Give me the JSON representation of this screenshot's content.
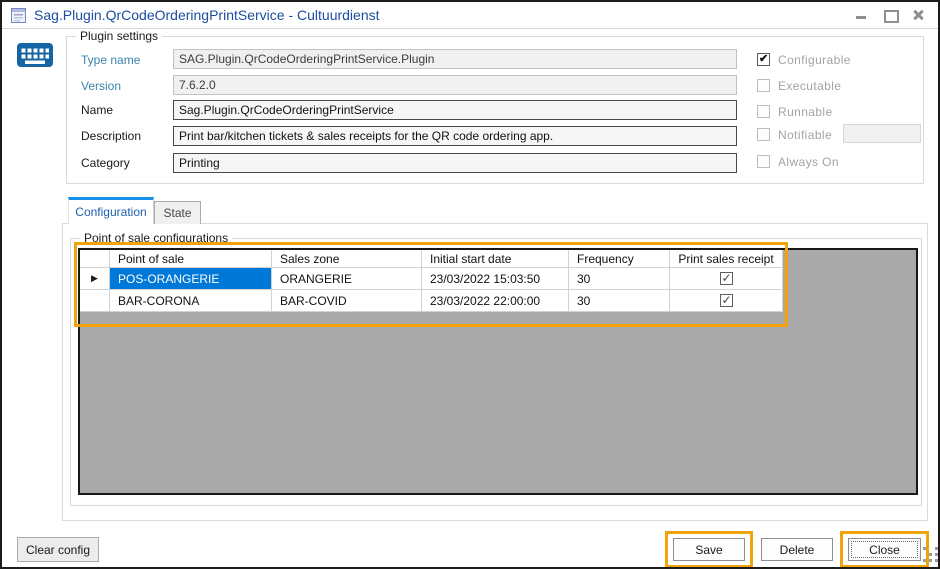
{
  "window": {
    "title": "Sag.Plugin.QrCodeOrderingPrintService - Cultuurdienst"
  },
  "plugin_settings": {
    "group_label": "Plugin settings",
    "fields": {
      "type_name": {
        "label": "Type name",
        "value": "SAG.Plugin.QrCodeOrderingPrintService.Plugin"
      },
      "version": {
        "label": "Version",
        "value": "7.6.2.0"
      },
      "name": {
        "label": "Name",
        "value": "Sag.Plugin.QrCodeOrderingPrintService"
      },
      "description": {
        "label": "Description",
        "value": "Print bar/kitchen tickets & sales receipts for the QR code ordering app."
      },
      "category": {
        "label": "Category",
        "value": "Printing"
      }
    },
    "checkboxes": {
      "configurable": {
        "label": "Configurable",
        "checked": true
      },
      "executable": {
        "label": "Executable",
        "checked": false
      },
      "runnable": {
        "label": "Runnable",
        "checked": false
      },
      "notifiable": {
        "label": "Notifiable",
        "checked": false,
        "textbox_value": ""
      },
      "always_on": {
        "label": "Always On",
        "checked": false
      }
    }
  },
  "tabs": {
    "configuration": "Configuration",
    "state": "State"
  },
  "pos_configurations": {
    "group_label": "Point of sale configurations",
    "grid": {
      "columns": [
        "Point of sale",
        "Sales zone",
        "Initial start date",
        "Frequency",
        "Print sales receipt"
      ],
      "rows": [
        {
          "point_of_sale": "POS-ORANGERIE",
          "sales_zone": "ORANGERIE",
          "initial_start_date": "23/03/2022 15:03:50",
          "frequency": "30",
          "print_sales_receipt": true,
          "current": true,
          "selected_cell": "point_of_sale"
        },
        {
          "point_of_sale": "BAR-CORONA",
          "sales_zone": "BAR-COVID",
          "initial_start_date": "23/03/2022 22:00:00",
          "frequency": "30",
          "print_sales_receipt": true,
          "current": false,
          "selected_cell": null
        }
      ]
    }
  },
  "footer_buttons": {
    "clear_config": "Clear config",
    "save": "Save",
    "delete": "Delete",
    "close": "Close"
  },
  "colors": {
    "selection_blue": "#0078d7",
    "title_blue": "#1c4da0",
    "annotation_orange": "#f0a30a",
    "field_label_teal": "#3a85ab",
    "grid_background_gray": "#a9a9a9",
    "keyboard_icon_blue": "#1565a5",
    "tab_active_accent": "#1690e8"
  }
}
